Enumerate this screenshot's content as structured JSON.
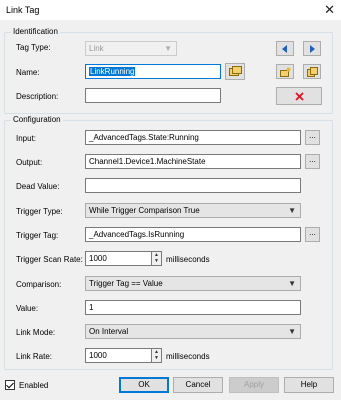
{
  "window": {
    "title": "Link Tag",
    "close_glyph": "✕"
  },
  "identification": {
    "legend": "Identification",
    "tag_type_label": "Tag Type:",
    "tag_type_value": "Link",
    "name_label": "Name:",
    "name_value": "LinkRunning",
    "description_label": "Description:",
    "description_value": ""
  },
  "configuration": {
    "legend": "Configuration",
    "input_label": "Input:",
    "input_value": "_AdvancedTags.State:Running",
    "output_label": "Output:",
    "output_value": "Channel1.Device1.MachineState",
    "dead_value_label": "Dead Value:",
    "dead_value_value": "",
    "trigger_type_label": "Trigger Type:",
    "trigger_type_value": "While Trigger Comparison True",
    "trigger_tag_label": "Trigger Tag:",
    "trigger_tag_value": "_AdvancedTags.IsRunning",
    "trigger_scan_rate_label": "Trigger Scan Rate:",
    "trigger_scan_rate_value": "1000",
    "trigger_scan_rate_unit": "milliseconds",
    "comparison_label": "Comparison:",
    "comparison_value": "Trigger Tag == Value",
    "value_label": "Value:",
    "value_value": "1",
    "link_mode_label": "Link Mode:",
    "link_mode_value": "On Interval",
    "link_rate_label": "Link Rate:",
    "link_rate_value": "1000",
    "link_rate_unit": "milliseconds"
  },
  "browse_label": "...",
  "footer": {
    "enabled_label": "Enabled",
    "enabled_checked": true,
    "ok_label": "OK",
    "cancel_label": "Cancel",
    "apply_label": "Apply",
    "help_label": "Help"
  },
  "colors": {
    "accent": "#0078d7",
    "dialog_bg": "#f0f0f0",
    "nav_arrow": "#1f5fbf",
    "delete_x": "#e81123",
    "tag_icon": "#e8b830"
  }
}
